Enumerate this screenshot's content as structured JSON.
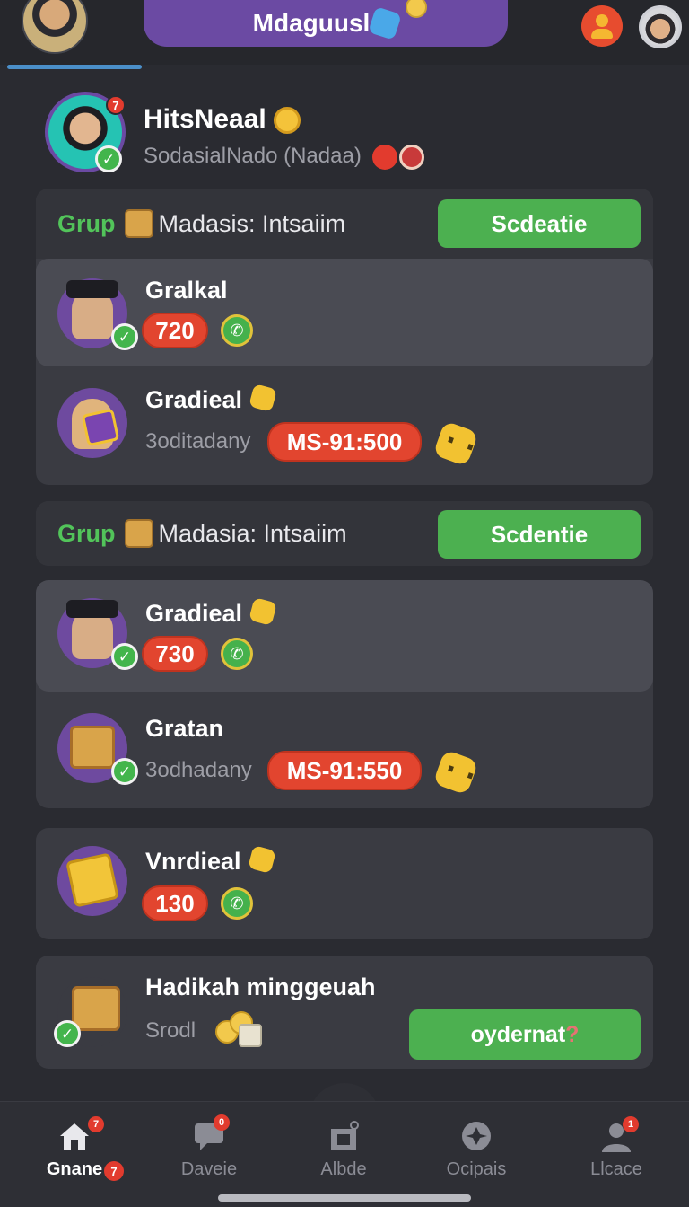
{
  "app": {
    "title": "Mdaguusl"
  },
  "header": {
    "badge_count": "7",
    "name": "HitsNeaal",
    "subtitle": "SodasialNado (Nadaa)"
  },
  "groups": [
    {
      "label": "Grup",
      "title": "Madasis: Intsaiim",
      "button": "Scdeatie",
      "rows": [
        {
          "name": "Gralkal",
          "score": "720",
          "highlight": true
        },
        {
          "name": "Gradieal",
          "sub": "3oditadany",
          "pill": "MS-91:500",
          "highlight": false
        }
      ]
    },
    {
      "label": "Grup",
      "title": "Madasia: Intsaiim",
      "button": "Scdentie"
    }
  ],
  "card2_rows": [
    {
      "name": "Gradieal",
      "score": "730"
    },
    {
      "name": "Gratan",
      "sub": "3odhadany",
      "pill": "MS-91:550"
    }
  ],
  "card3_row": {
    "name": "Vnrdieal",
    "score": "130"
  },
  "card4": {
    "name": "Hadikah minggeuah",
    "sub": "Srodl",
    "button": "oydernat",
    "button_mark": "?"
  },
  "nav": [
    {
      "label": "Gnane",
      "badge": "7",
      "icon": "home-icon"
    },
    {
      "label": "Daveie",
      "badge": "0",
      "icon": "chat-icon"
    },
    {
      "label": "Albde",
      "badge": "",
      "icon": "shop-icon"
    },
    {
      "label": "Ocipais",
      "badge": "",
      "icon": "settings-icon"
    },
    {
      "label": "Llcace",
      "badge": "1",
      "icon": "profile-icon"
    }
  ],
  "colors": {
    "accent_purple": "#6b4aa3",
    "accent_green": "#4cb050",
    "accent_red": "#e2452f",
    "background": "#2a2b31"
  }
}
